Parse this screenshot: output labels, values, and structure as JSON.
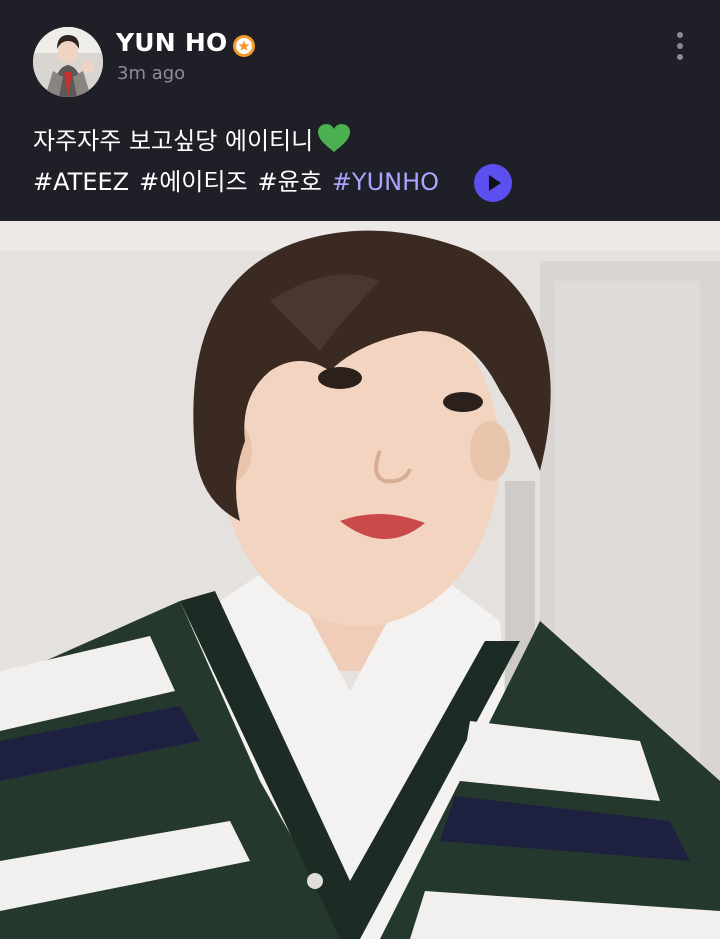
{
  "post": {
    "author": {
      "name": "YUN HO",
      "badge_icon": "verified-star-icon",
      "badge_color": "#f39a2b"
    },
    "timestamp": "3m ago",
    "caption": "자주자주 보고싶당 에이티니",
    "caption_emoji": "green-heart-icon",
    "hashtags": [
      "#ATEEZ",
      "#에이티즈",
      "#윤호",
      "#YUNHO"
    ],
    "translate_icon": "play-icon",
    "menu_icon": "more-vertical-icon"
  },
  "colors": {
    "background": "#1f2027",
    "text": "#ffffff",
    "muted": "#8d8e94",
    "hashtag_highlight": "#a9a4ff",
    "accent": "#5b4ff0",
    "heart": "#4caf50"
  }
}
